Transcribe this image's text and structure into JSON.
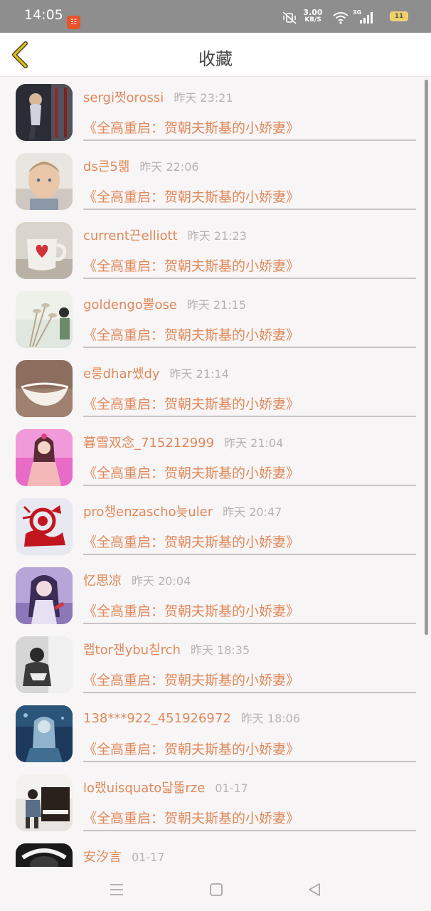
{
  "status_bar": {
    "time": "14:05",
    "app_badge": "☷",
    "speed_value": "3.00",
    "speed_unit": "KB/S",
    "network": "3G",
    "battery": "11"
  },
  "header": {
    "title": "收藏",
    "back_icon": "chevron-left-icon"
  },
  "items": [
    {
      "user": "sergi쩟orossi",
      "time": "昨天 23:21",
      "book": "《全高重启：贺朝夫斯基的小娇妻》",
      "avatar": "gym-photo"
    },
    {
      "user": "ds큰5렒",
      "time": "昨天 22:06",
      "book": "《全高重启：贺朝夫斯基的小娇妻》",
      "avatar": "child-portrait"
    },
    {
      "user": "current끈elliott",
      "time": "昨天 21:23",
      "book": "《全高重启：贺朝夫斯基的小娇妻》",
      "avatar": "heart-mug"
    },
    {
      "user": "goldengo뿔ose",
      "time": "昨天 21:15",
      "book": "《全高重启：贺朝夫斯基的小娇妻》",
      "avatar": "dried-flowers"
    },
    {
      "user": "e룽dhar쎘dy",
      "time": "昨天 21:14",
      "book": "《全高重启：贺朝夫斯基的小娇妻》",
      "avatar": "white-bowl"
    },
    {
      "user": "暮雪双念_715212999",
      "time": "昨天 21:04",
      "book": "《全高重启：贺朝夫斯基的小娇妻》",
      "avatar": "anime-girl-pink"
    },
    {
      "user": "pro챙enzascho늦uler",
      "time": "昨天 20:47",
      "book": "《全高重启：贺朝夫斯基的小娇妻》",
      "avatar": "red-papercut"
    },
    {
      "user": "忆思凉",
      "time": "昨天 20:04",
      "book": "《全高重启：贺朝夫斯基的小娇妻》",
      "avatar": "anime-girl-purple"
    },
    {
      "user": "랩tor잰ybu칟rch",
      "time": "昨天 18:35",
      "book": "《全高重启：贺朝夫斯基的小娇妻》",
      "avatar": "bw-photo"
    },
    {
      "user": "138***922_451926972",
      "time": "昨天 18:06",
      "book": "《全高重启：贺朝夫斯基的小娇妻》",
      "avatar": "blue-anime"
    },
    {
      "user": "lo랬uisquato닯똛rze",
      "time": "01-17",
      "book": "《全高重启：贺朝夫斯基的小娇妻》",
      "avatar": "piano-boy"
    },
    {
      "user": "安汐言",
      "time": "01-17",
      "book": "",
      "avatar": "dark-photo"
    }
  ],
  "nav": {
    "menu_icon": "menu-icon",
    "home_icon": "square-icon",
    "back_icon": "triangle-back-icon"
  },
  "colors": {
    "accent": "#e0895a",
    "timestamp": "#b7b2b2",
    "back_arrow": "#e6c200"
  }
}
